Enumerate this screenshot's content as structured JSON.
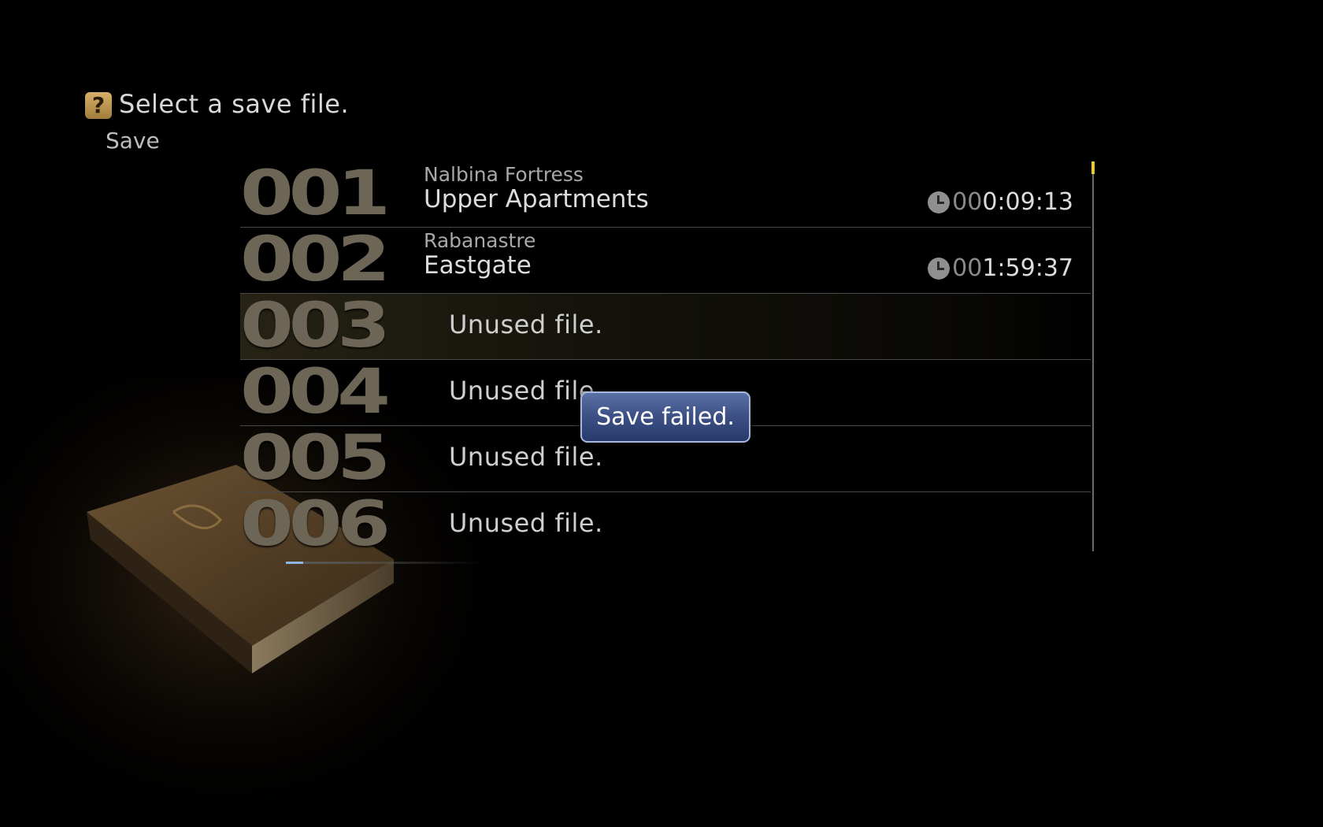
{
  "header": {
    "help_icon_glyph": "?",
    "prompt": "Select a save file.",
    "mode": "Save"
  },
  "slots": [
    {
      "number": "001",
      "region": "Nalbina Fortress",
      "area": "Upper Apartments",
      "time_lead": "00",
      "time": "0:09:13",
      "empty": ""
    },
    {
      "number": "002",
      "region": "Rabanastre",
      "area": "Eastgate",
      "time_lead": "00",
      "time": "1:59:37",
      "empty": ""
    },
    {
      "number": "003",
      "region": "",
      "area": "",
      "time_lead": "",
      "time": "",
      "empty": "Unused file."
    },
    {
      "number": "004",
      "region": "",
      "area": "",
      "time_lead": "",
      "time": "",
      "empty": "Unused file."
    },
    {
      "number": "005",
      "region": "",
      "area": "",
      "time_lead": "",
      "time": "",
      "empty": "Unused file."
    },
    {
      "number": "006",
      "region": "",
      "area": "",
      "time_lead": "",
      "time": "",
      "empty": "Unused file."
    }
  ],
  "selected_slot": "003",
  "dialog": {
    "message": "Save failed."
  },
  "icons": {
    "help": "question-mark-icon",
    "playtime": "clock-icon"
  },
  "colors": {
    "accent_scroll": "#e8c840",
    "dialog_bg": "#3e5287",
    "slot_number": "#6d6656"
  }
}
